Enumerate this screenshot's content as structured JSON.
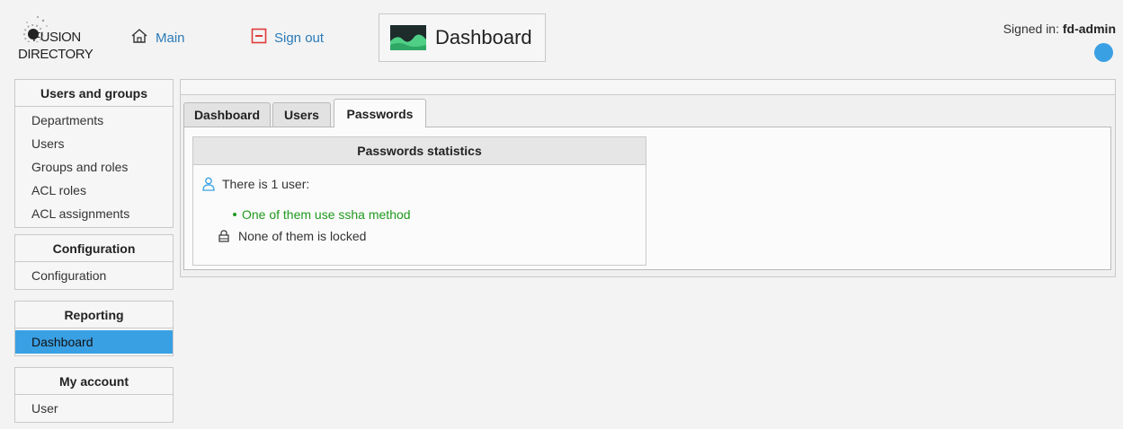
{
  "header": {
    "logo_line1": "FUSION",
    "logo_line2": "DIRECTORY",
    "main_link": "Main",
    "signout_link": "Sign out",
    "plugin_title": "Dashboard",
    "signed_in_label": "Signed in:",
    "signed_in_user": "fd-admin"
  },
  "sidebar": {
    "sections": [
      {
        "title": "Users and groups",
        "items": [
          "Departments",
          "Users",
          "Groups and roles",
          "ACL roles",
          "ACL assignments"
        ]
      },
      {
        "title": "Configuration",
        "items": [
          "Configuration"
        ]
      },
      {
        "title": "Reporting",
        "items": [
          "Dashboard"
        ]
      },
      {
        "title": "My account",
        "items": [
          "User"
        ]
      }
    ]
  },
  "tabs": [
    "Dashboard",
    "Users",
    "Passwords"
  ],
  "active_tab": "Passwords",
  "stats": {
    "title": "Passwords statistics",
    "user_count_text": "There is 1 user:",
    "method_text": "One of them use ssha method",
    "locked_text": "None of them is locked"
  },
  "colors": {
    "accent": "#3aa0e4",
    "link": "#2a7ab8",
    "success": "#1f9a1f",
    "signout": "#e03a3a"
  }
}
